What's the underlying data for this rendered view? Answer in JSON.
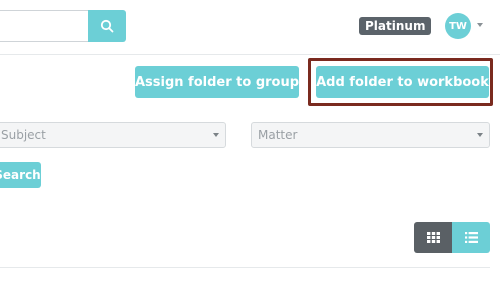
{
  "header": {
    "search": {
      "value": "",
      "placeholder": ""
    },
    "plan_badge": "Platinum",
    "user_initials": "TW"
  },
  "actions": {
    "assign_label": "Assign folder to group",
    "add_label": "Add folder to workbook"
  },
  "filters": {
    "subject": "Subject",
    "matter": "Matter",
    "search_label": "Search"
  },
  "view_toggle": {
    "active": "list"
  },
  "colors": {
    "accent": "#6ccfd6",
    "dark": "#5a6065",
    "highlight": "#7a2a1f"
  }
}
